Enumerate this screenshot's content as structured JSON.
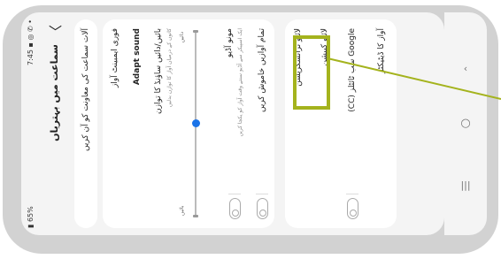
{
  "status_bar": {
    "time": "7:45",
    "battery": "65%"
  },
  "header": {
    "title": "سماعت میں بہتریاں"
  },
  "card1": {
    "text": "آلات سماعت کی معاونت کو آن کریں"
  },
  "card2": {
    "ambient": "فوری ایمبینٹ آواز",
    "adapt": "Adapt sound",
    "balance_title": "بائیں/دائیں ساؤنڈ کا توازن",
    "balance_sub": "کانوں کے درمیان آواز کا توازن بدلیں",
    "slider_left": "بائیں",
    "slider_right": "دائیں",
    "slider_value": 0.5,
    "mono_title": "مونو آڈیو",
    "mono_sub": "ایک اسپیکر سے آڈیو سنتے وقت آواز کو یکجا کریں",
    "mute_all": "تمام آوازیں خاموش کریں"
  },
  "card3": {
    "live_transcribe": "لائیو ٹرانسکرپشن",
    "live_caption": "لائیو کیپشن",
    "google_cc": "Google سب ٹائٹلز (CC)",
    "sound_detectors": "آواز کا ڈیٹیکٹر"
  },
  "nav": {
    "back_icon": "chevron-icon",
    "home_icon": "circle-icon",
    "recents_icon": "menu-icon"
  },
  "colors": {
    "highlight": "#a4b31d",
    "accent": "#1a73e8"
  }
}
